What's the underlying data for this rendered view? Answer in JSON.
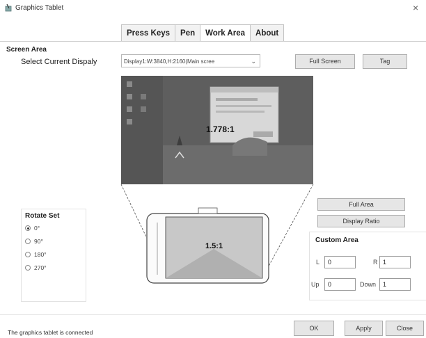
{
  "window": {
    "title": "Graphics Tablet",
    "app_icon": "pen-tablet-icon",
    "close_glyph": "×"
  },
  "tabs": [
    {
      "label": "Press Keys",
      "active": false
    },
    {
      "label": "Pen",
      "active": false
    },
    {
      "label": "Work Area",
      "active": true
    },
    {
      "label": "About",
      "active": false
    }
  ],
  "screen_area": {
    "section_label": "Screen Area",
    "select_label": "Select Current Dispaly",
    "display_value": "Display1:W:3840,H:2160(Main scree",
    "full_screen_label": "Full Screen",
    "tag_label": "Tag",
    "ratio": "1.778:1"
  },
  "tablet": {
    "ratio": "1.5:1"
  },
  "rotate": {
    "title": "Rotate Set",
    "options": [
      "0°",
      "90°",
      "180°",
      "270°"
    ],
    "selected": "0°"
  },
  "area_buttons": {
    "full_area_label": "Full Area",
    "display_ratio_label": "Display Ratio"
  },
  "custom_area": {
    "title": "Custom Area",
    "l_label": "L",
    "l_value": "0",
    "r_label": "R",
    "r_value": "1",
    "up_label": "Up",
    "up_value": "0",
    "down_label": "Down",
    "down_value": "1"
  },
  "footer": {
    "status": "The graphics tablet is connected",
    "ok_label": "OK",
    "apply_label": "Apply",
    "close_label": "Close"
  },
  "colors": {
    "preview_bg": "#5e5e5e",
    "tablet_active_area": "#c8c8c8",
    "button_bg": "#e6e6e6"
  }
}
